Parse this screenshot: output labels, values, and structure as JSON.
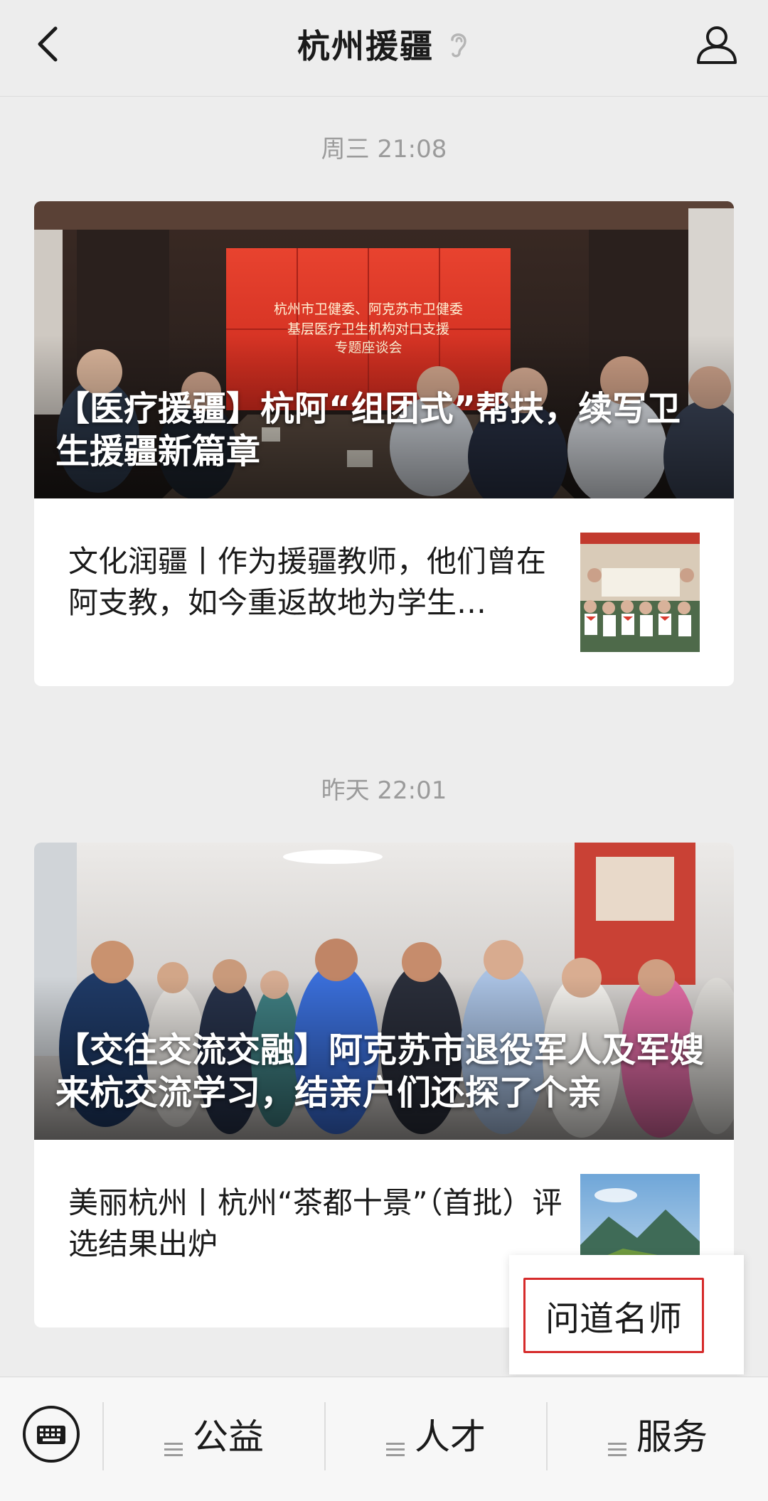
{
  "header": {
    "title": "杭州援疆"
  },
  "feed": [
    {
      "timestamp": "周三 21:08",
      "headline": "【医疗援疆】杭阿“组团式”帮扶，续写卫生援疆新篇章",
      "banner_text": "杭州市卫健委、阿克苏市卫健委\n基层医疗卫生机构对口支援\n专题座谈会",
      "sub_title": "文化润疆丨作为援疆教师，他们曾在阿支教，如今重返故地为学生…"
    },
    {
      "timestamp": "昨天 22:01",
      "headline": "【交往交流交融】阿克苏市退役军人及军嫂来杭交流学习，结亲户们还探了个亲",
      "sub_title": "美丽杭州丨杭州“茶都十景”（首批）评选结果出炉"
    }
  ],
  "popup": {
    "item": "问道名师"
  },
  "bottom_menu": {
    "items": [
      "公益",
      "人才",
      "服务"
    ]
  },
  "icons": {
    "back": "chevron-left-icon",
    "ear": "ear-icon",
    "profile": "person-icon",
    "keyboard": "keyboard-icon",
    "menu": "hamburger-icon"
  },
  "colors": {
    "background": "#ededed",
    "highlight_border": "#d62b2b",
    "timestamp": "#9b9b9b"
  }
}
